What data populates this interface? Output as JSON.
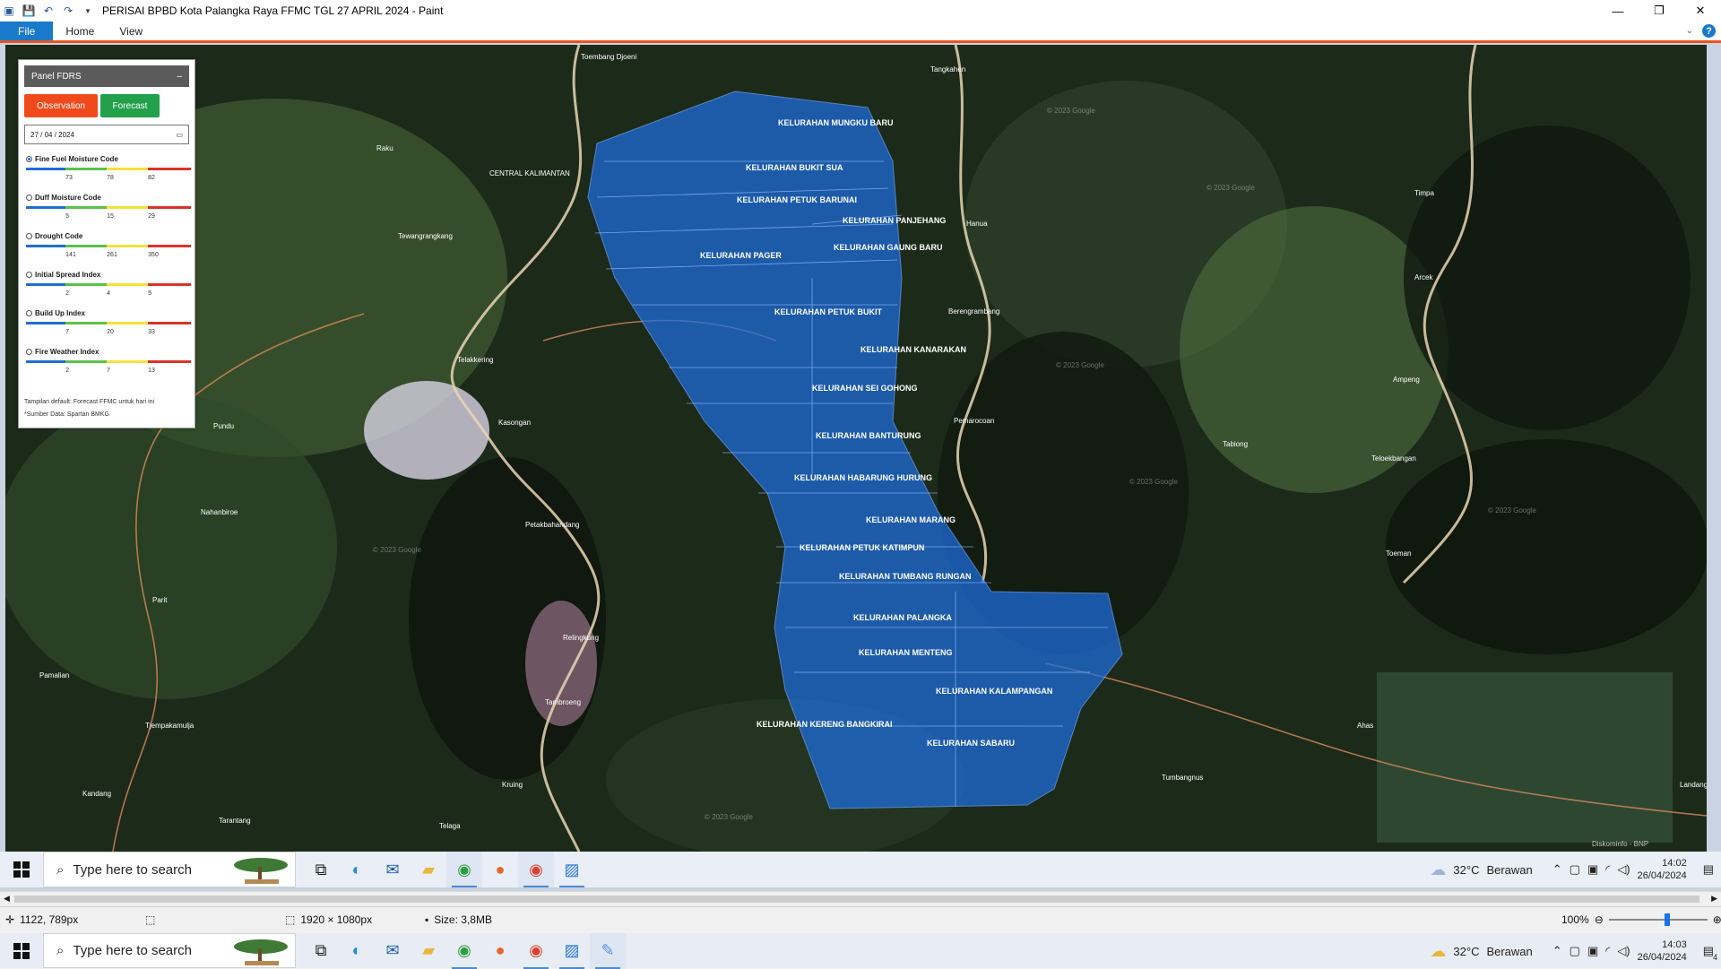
{
  "window": {
    "title": "PERISAI BPBD Kota Palangka Raya FFMC TGL 27 APRIL 2024 - Paint",
    "minimize": "—",
    "maximize": "❐",
    "close": "✕"
  },
  "ribbon": {
    "tabs": [
      "File",
      "Home",
      "View"
    ]
  },
  "panel": {
    "title": "Panel FDRS",
    "collapse": "–",
    "observation_label": "Observation",
    "forecast_label": "Forecast",
    "date_value": "27 / 04 / 2024",
    "indices": [
      {
        "name": "Fine Fuel Moisture Code",
        "selected": true,
        "ticks": [
          "73",
          "78",
          "82"
        ]
      },
      {
        "name": "Duff Moisture Code",
        "selected": false,
        "ticks": [
          "5",
          "15",
          "29"
        ]
      },
      {
        "name": "Drought Code",
        "selected": false,
        "ticks": [
          "141",
          "261",
          "350"
        ]
      },
      {
        "name": "Initial Spread Index",
        "selected": false,
        "ticks": [
          "2",
          "4",
          "5"
        ]
      },
      {
        "name": "Build Up Index",
        "selected": false,
        "ticks": [
          "7",
          "20",
          "33"
        ]
      },
      {
        "name": "Fire Weather Index",
        "selected": false,
        "ticks": [
          "2",
          "7",
          "13"
        ]
      }
    ],
    "note1": "Tampilan default: Forecast FFMC untuk hari ini",
    "note2": "*Sumber Data: Spartan BMKG",
    "colors": {
      "blue": "#1f6fd1",
      "green": "#5cc24a",
      "yellow": "#f2e33a",
      "red": "#d9332b"
    }
  },
  "map": {
    "kelurahan": [
      "KELURAHAN MUNGKU BARU",
      "KELURAHAN BUKIT SUA",
      "KELURAHAN PETUK BARUNAI",
      "KELURAHAN PANJEHANG",
      "KELURAHAN GAUNG BARU",
      "KELURAHAN PAGER",
      "KELURAHAN PETUK BUKIT",
      "KELURAHAN KANARAKAN",
      "KELURAHAN SEI GOHONG",
      "KELURAHAN BANTURUNG",
      "KELURAHAN HABARUNG HURUNG",
      "KELURAHAN MARANG",
      "KELURAHAN PETUK KATIMPUN",
      "KELURAHAN TUMBANG RUNGAN",
      "KELURAHAN PALANGKA",
      "KELURAHAN MENTENG",
      "KELURAHAN KALAMPANGAN",
      "KELURAHAN KERENG BANGKIRAI",
      "KELURAHAN SABARU"
    ],
    "towns": [
      "Tangkahen",
      "Toembang Djoeni",
      "Raku",
      "CENTRAL KALIMANTAN",
      "Tewangrangkang",
      "Telakkering",
      "Pundu",
      "Kasongan",
      "Nahanbiroe",
      "Petakbahandang",
      "Parit",
      "Pamalian",
      "Tjempakamulja",
      "Kandang",
      "Tarantang",
      "Telaga",
      "Kruing",
      "Tambroeng",
      "Relingkung",
      "Hanua",
      "Berengrambang",
      "Pemarocoan",
      "Timpa",
      "Arcek",
      "Ampeng",
      "Tabiong",
      "Teloekbangan",
      "Toeman",
      "Ahas",
      "Tumbangnus",
      "Landangs"
    ],
    "watermark": "© 2023 Google",
    "attribution": "Diskominfo - BNP"
  },
  "inner_taskbar": {
    "search_placeholder": "Type here to search",
    "weather_temp": "32°C",
    "weather_desc": "Berawan",
    "time": "14:02",
    "date": "26/04/2024"
  },
  "statusbar": {
    "cursor_pos": "1122, 789px",
    "image_size": "1920 × 1080px",
    "file_size": "Size: 3,8MB",
    "zoom": "100%"
  },
  "taskbar": {
    "search_placeholder": "Type here to search",
    "weather_temp": "32°C",
    "weather_desc": "Berawan",
    "time": "14:03",
    "date": "26/04/2024",
    "notifications": "4"
  }
}
